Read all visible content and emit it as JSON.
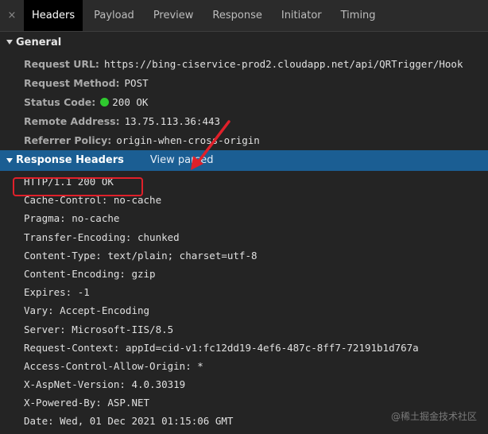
{
  "tabs": {
    "close_glyph": "×",
    "items": [
      "Headers",
      "Payload",
      "Preview",
      "Response",
      "Initiator",
      "Timing"
    ],
    "active": "Headers"
  },
  "general": {
    "title": "General",
    "rows": [
      {
        "label": "Request URL:",
        "value": "https://bing-ciservice-prod2.cloudapp.net/api/QRTrigger/Hook"
      },
      {
        "label": "Request Method:",
        "value": "POST"
      },
      {
        "label": "Status Code:",
        "value": "200 OK",
        "status_color": "#2fca2f"
      },
      {
        "label": "Remote Address:",
        "value": "13.75.113.36:443"
      },
      {
        "label": "Referrer Policy:",
        "value": "origin-when-cross-origin"
      }
    ]
  },
  "response_headers": {
    "title": "Response Headers",
    "view_parsed": "View parsed",
    "status_line": "HTTP/1.1 200 OK",
    "rows": [
      "Cache-Control: no-cache",
      "Pragma: no-cache",
      "Transfer-Encoding: chunked",
      "Content-Type: text/plain; charset=utf-8",
      "Content-Encoding: gzip",
      "Expires: -1",
      "Vary: Accept-Encoding",
      "Server: Microsoft-IIS/8.5",
      "Request-Context: appId=cid-v1:fc12dd19-4ef6-487c-8ff7-72191b1d767a",
      "Access-Control-Allow-Origin: *",
      "X-AspNet-Version: 4.0.30319",
      "X-Powered-By: ASP.NET",
      "Date: Wed, 01 Dec 2021 01:15:06 GMT"
    ]
  },
  "watermark": "@稀土掘金技术社区",
  "colors": {
    "highlight": "#e0202a",
    "header_bar": "#1b5e93"
  }
}
